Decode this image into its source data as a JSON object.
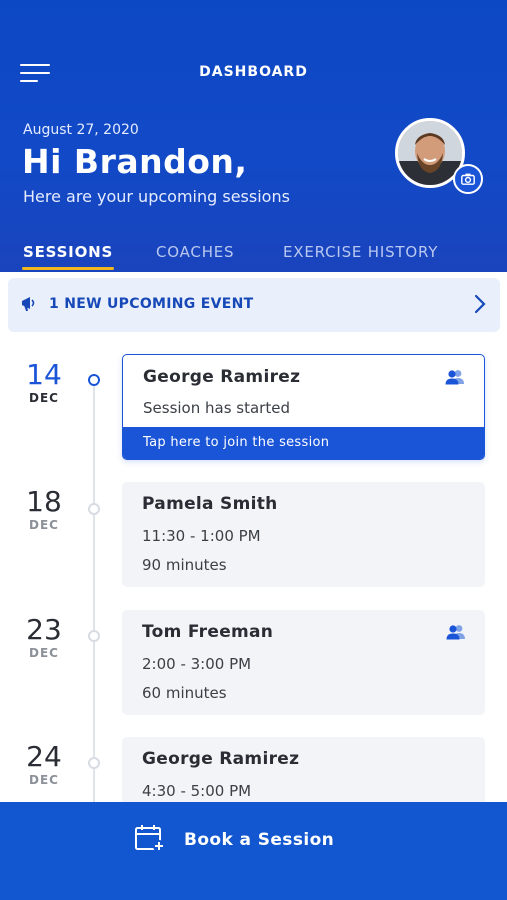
{
  "header": {
    "title": "DASHBOARD",
    "date": "August 27, 2020",
    "greeting": "Hi Brandon,",
    "subtitle": "Here are your upcoming sessions"
  },
  "tabs": [
    {
      "label": "SESSIONS",
      "active": true
    },
    {
      "label": "COACHES",
      "active": false
    },
    {
      "label": "EXERCISE HISTORY",
      "active": false
    }
  ],
  "banner": {
    "text": "1 NEW UPCOMING EVENT",
    "icon": "megaphone-icon"
  },
  "sessions": [
    {
      "day": "14",
      "month": "DEC",
      "name": "George Ramirez",
      "line1": "Session has started",
      "action": "Tap here to join the session",
      "group": true,
      "active": true
    },
    {
      "day": "18",
      "month": "DEC",
      "name": "Pamela Smith",
      "line1": "11:30 - 1:00 PM",
      "line2": "90 minutes",
      "group": false,
      "active": false
    },
    {
      "day": "23",
      "month": "DEC",
      "name": "Tom Freeman",
      "line1": "2:00 - 3:00 PM",
      "line2": "60 minutes",
      "group": true,
      "active": false
    },
    {
      "day": "24",
      "month": "DEC",
      "name": "George Ramirez",
      "line1": "4:30 - 5:00 PM",
      "group": false,
      "active": false
    }
  ],
  "footer": {
    "book_label": "Book a Session",
    "icon": "calendar-add-icon"
  },
  "colors": {
    "primary": "#1a55d8",
    "header_bg": "#1249c6",
    "accent": "#f2b71f"
  }
}
